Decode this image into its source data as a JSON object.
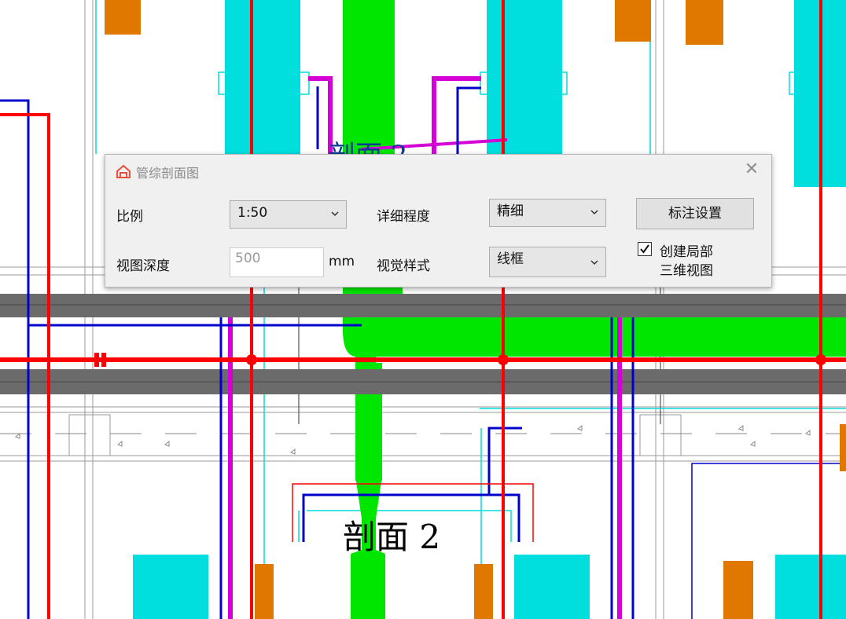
{
  "drawing": {
    "section_labels": [
      "剖面 2",
      "剖面 2"
    ]
  },
  "dialog": {
    "title": "管综剖面图",
    "scale_label": "比例",
    "scale_value": "1:50",
    "detail_label": "详细程度",
    "detail_value": "精细",
    "annotate_button": "标注设置",
    "view_depth_label": "视图深度",
    "view_depth_value": "500",
    "view_depth_unit": "mm",
    "visual_style_label": "视觉样式",
    "visual_style_value": "线框",
    "create_local_3d_line1": "创建局部",
    "create_local_3d_line2": "三维视图",
    "create_local_3d_checked": true,
    "close_icon": "close-icon",
    "logo_icon": "app-logo-icon"
  },
  "colors": {
    "duct_green": "#00e600",
    "duct_cyan": "#00dede",
    "pipe_red": "#ff0000",
    "pipe_blue": "#0000cc",
    "pipe_magenta": "#d400d4",
    "equipment_orange": "#e07800",
    "beam_grey": "#6b6b6b"
  }
}
